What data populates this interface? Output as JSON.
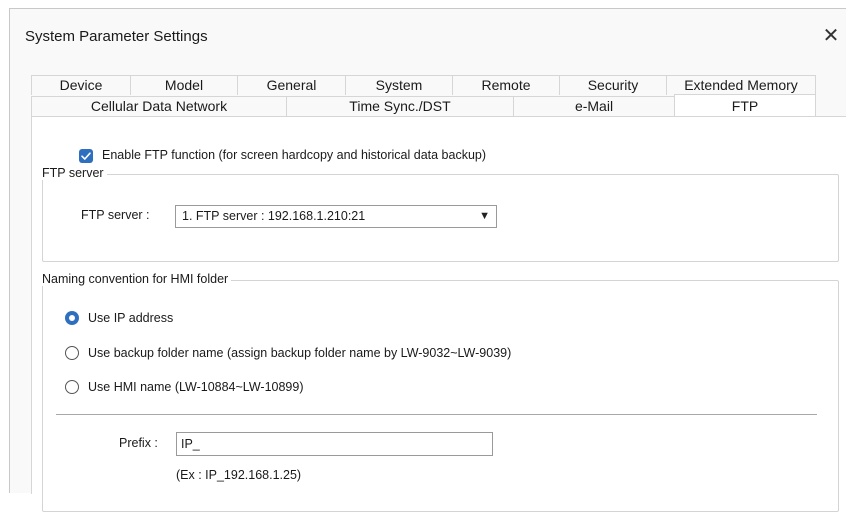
{
  "window": {
    "title": "System Parameter Settings",
    "close_glyph": "✕"
  },
  "tabs": {
    "row1": [
      "Device",
      "Model",
      "General",
      "System",
      "Remote",
      "Security",
      "Extended Memory"
    ],
    "row2": [
      "Cellular Data Network",
      "Time Sync./DST",
      "e-Mail",
      "FTP"
    ],
    "active": "FTP"
  },
  "ftp": {
    "enable_label": "Enable FTP function (for screen hardcopy and historical data backup)",
    "enable_checked": true,
    "server_group": {
      "legend": "FTP server",
      "label": "FTP server :",
      "selected": "1. FTP server : 192.168.1.210:21",
      "dropdown_icon": "caret-down-icon"
    },
    "naming_group": {
      "legend": "Naming convention for HMI folder",
      "options": [
        {
          "label": "Use IP address",
          "selected": true
        },
        {
          "label": "Use backup folder name (assign backup folder name by LW-9032~LW-9039)",
          "selected": false
        },
        {
          "label": "Use HMI name (LW-10884~LW-10899)",
          "selected": false
        }
      ],
      "prefix_label": "Prefix :",
      "prefix_value": "IP_",
      "example": "(Ex : IP_192.168.1.25)"
    }
  },
  "colors": {
    "accent": "#2f6fbf",
    "window_bg": "#f9f9f9",
    "panel_bg": "#ffffff"
  }
}
